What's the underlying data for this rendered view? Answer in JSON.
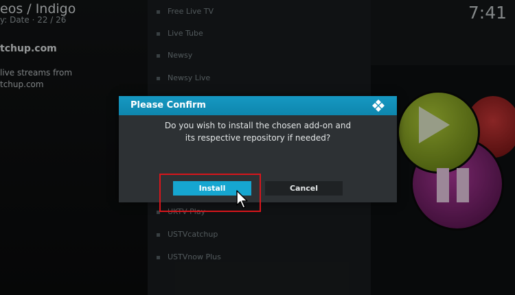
{
  "header": {
    "breadcrumb": "eos / Indigo",
    "sort_info": "y: Date  ·  22 / 26",
    "clock": "7:41"
  },
  "addon_info": {
    "title": "tchup.com",
    "description_line1": "live streams from",
    "description_line2": "tchup.com"
  },
  "list": {
    "items": [
      "Free Live TV",
      "Live Tube",
      "Newsy",
      "Newsy Live",
      "UKTV Play",
      "USTVcatchup",
      "USTVnow Plus"
    ]
  },
  "dialog": {
    "title": "Please Confirm",
    "message_line1": "Do you wish to install the chosen add-on and",
    "message_line2": "its respective repository if needed?",
    "install_label": "Install",
    "cancel_label": "Cancel"
  },
  "colors": {
    "accent": "#12a0c9",
    "highlight_box": "#d9151b"
  },
  "icons": {
    "logo": "kodi-logo-icon",
    "pointer": "mouse-cursor-icon"
  }
}
